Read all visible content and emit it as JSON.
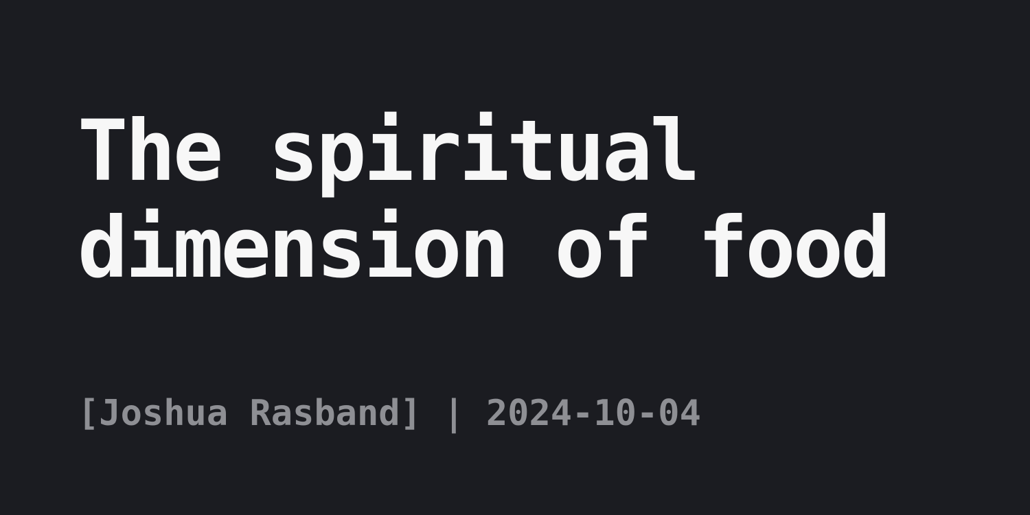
{
  "post": {
    "title": "The spiritual dimension of food",
    "meta": "[Joshua Rasband] | 2024-10-04"
  },
  "colors": {
    "background": "#1b1c21",
    "title": "#f7f7f7",
    "meta": "#8e8f94"
  }
}
